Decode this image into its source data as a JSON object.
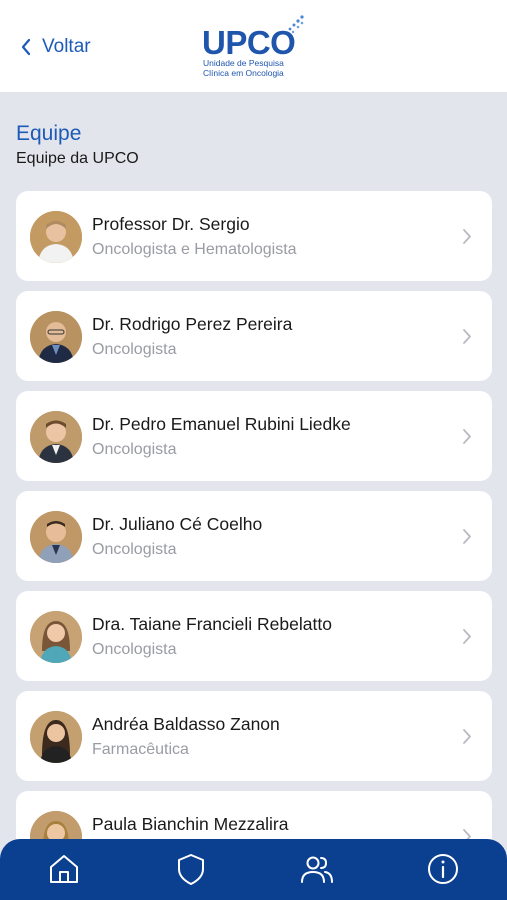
{
  "header": {
    "back_label": "Voltar",
    "logo": {
      "wordmark": "UPCO",
      "subtitle_line1": "Unidade de Pesquisa",
      "subtitle_line2": "Clínica em Oncologia"
    }
  },
  "page": {
    "title": "Equipe",
    "subtitle": "Equipe da UPCO"
  },
  "team": [
    {
      "name": "Professor Dr. Sergio",
      "role": "Oncologista e Hematologista"
    },
    {
      "name": "Dr. Rodrigo Perez Pereira",
      "role": "Oncologista"
    },
    {
      "name": "Dr. Pedro Emanuel Rubini Liedke",
      "role": "Oncologista"
    },
    {
      "name": "Dr. Juliano Cé Coelho",
      "role": "Oncologista"
    },
    {
      "name": "Dra. Taiane Francieli Rebelatto",
      "role": "Oncologista"
    },
    {
      "name": "Andréa Baldasso Zanon",
      "role": "Farmacêutica"
    },
    {
      "name": "Paula Bianchin Mezzalira",
      "role": ""
    }
  ],
  "tabbar": {
    "items": [
      {
        "icon": "home-icon"
      },
      {
        "icon": "shield-icon"
      },
      {
        "icon": "users-icon"
      },
      {
        "icon": "info-icon"
      }
    ]
  },
  "colors": {
    "accent": "#1c5bb8",
    "tabbar": "#0b3f8f",
    "background": "#e3e5ec",
    "secondary_text": "#9a9ca3"
  }
}
